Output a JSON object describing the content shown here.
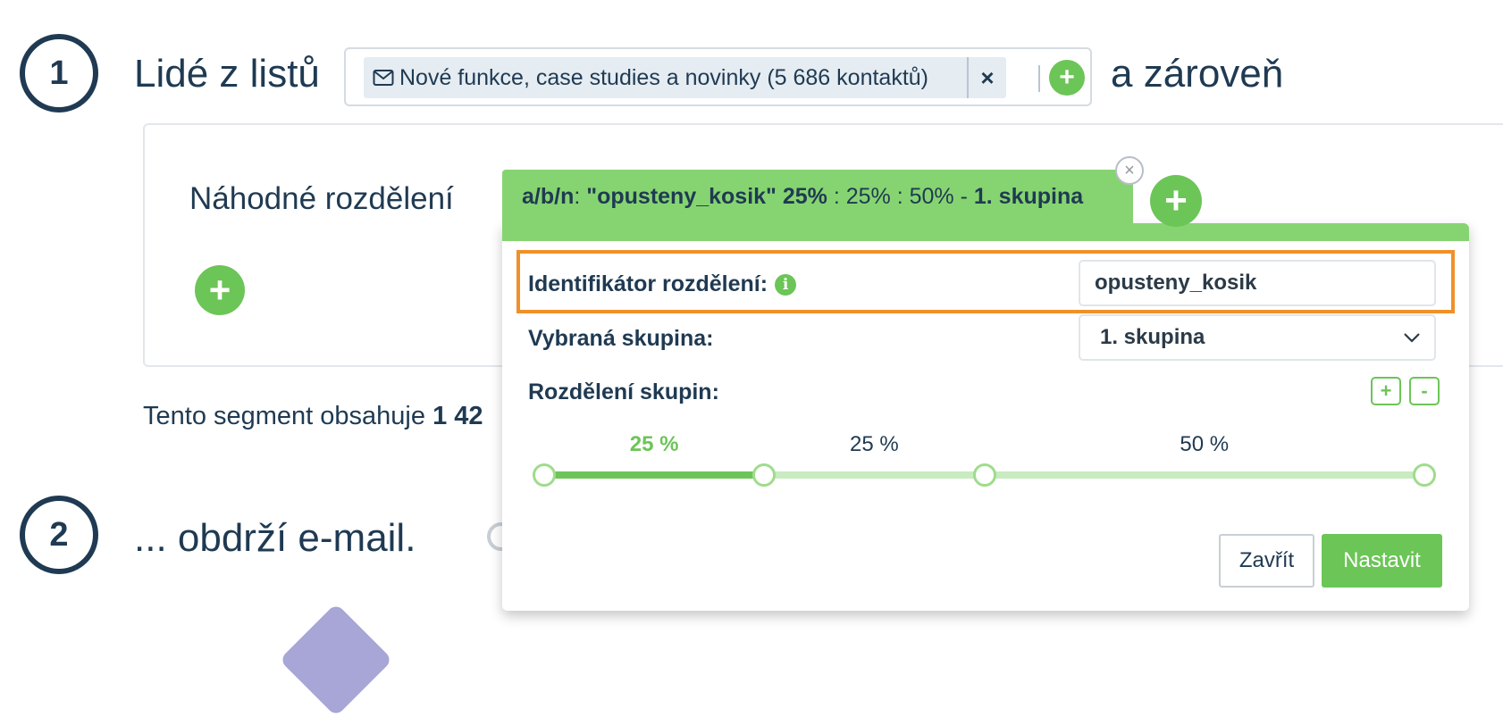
{
  "step1": {
    "number": "1",
    "title": "Lidé z listů",
    "list_tag": "Nové funkce, case studies a novinky (5 686 kontaktů)",
    "remove_symbol": "×",
    "add_symbol": "+",
    "and_text": "a zároveň"
  },
  "condition": {
    "label": "Náhodné rozdělení",
    "add_symbol": "+"
  },
  "segment_text": "Tento segment obsahuje",
  "segment_count_partial": "1 42",
  "step2": {
    "number": "2",
    "title": "... obdrží e-mail."
  },
  "ab_tab": {
    "prefix": "a/b/n",
    "colon": ": ",
    "name": "\"opusteny_kosik\" 25%",
    "rest": " : 25% : 50% - ",
    "group": "1. skupina",
    "add_symbol": "+",
    "close_symbol": "×"
  },
  "panel": {
    "identifier_label": "Identifikátor rozdělení:",
    "info_symbol": "i",
    "identifier_value": "opusteny_kosik",
    "selected_group_label": "Vybraná skupina:",
    "selected_group_value": "1. skupina",
    "split_label": "Rozdělení skupin:",
    "plus_label": "+",
    "minus_label": "-",
    "split": [
      {
        "label": "25 %",
        "value": 25,
        "active": true
      },
      {
        "label": "25 %",
        "value": 25,
        "active": false
      },
      {
        "label": "50 %",
        "value": 50,
        "active": false
      }
    ],
    "close_button": "Zavřít",
    "submit_button": "Nastavit"
  },
  "colors": {
    "accent_green": "#6cc557",
    "tab_green": "#86d471",
    "navy": "#1f3a52",
    "highlight_orange": "#f0902a",
    "track_light": "#c8ebbf"
  }
}
